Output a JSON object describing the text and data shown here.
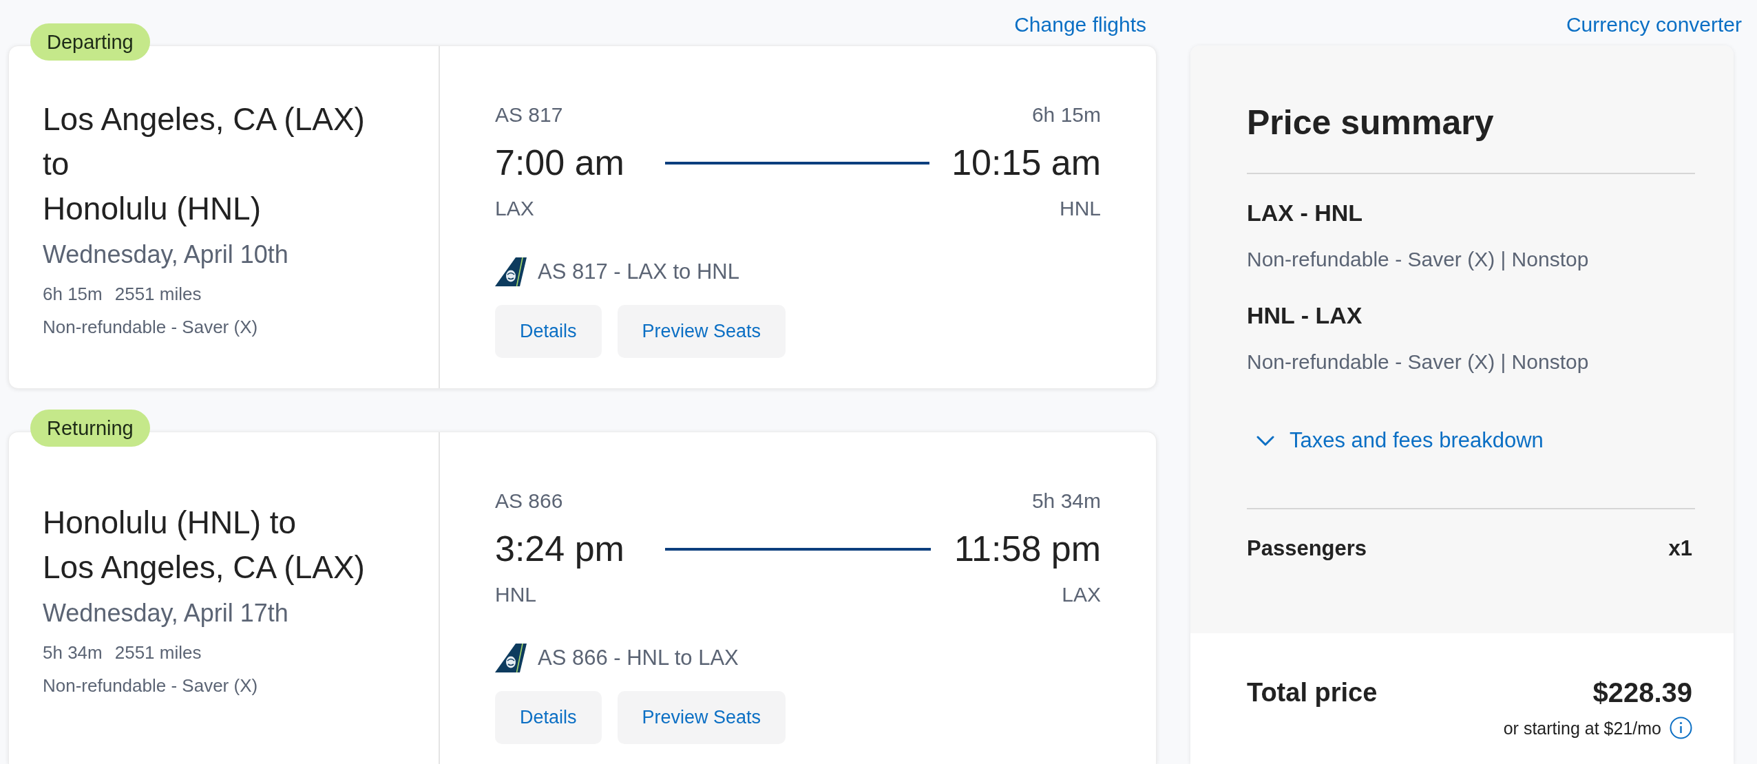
{
  "itinerary": {
    "link": "Change flights",
    "flights": [
      {
        "badge": "Departing",
        "route_lines": [
          "Los Angeles, CA (LAX)",
          "to",
          "Honolulu (HNL)"
        ],
        "date": "Wednesday, April 10th",
        "duration": "6h 15m",
        "distance": "2551 miles",
        "fare": "Non-refundable - Saver (X)",
        "flight_number": "AS 817",
        "total_time": "6h 15m",
        "depart_time": "7:00 am",
        "arrive_time": "10:15 am",
        "origin": "LAX",
        "destination": "HNL",
        "segment": "AS 817 - LAX to HNL",
        "buttons": [
          "Details",
          "Preview Seats"
        ]
      },
      {
        "badge": "Returning",
        "route_lines": [
          "Honolulu (HNL) to",
          "Los Angeles, CA (LAX)"
        ],
        "date": "Wednesday, April 17th",
        "duration": "5h 34m",
        "distance": "2551 miles",
        "fare": "Non-refundable - Saver (X)",
        "flight_number": "AS 866",
        "total_time": "5h 34m",
        "depart_time": "3:24 pm",
        "arrive_time": "11:58 pm",
        "origin": "HNL",
        "destination": "LAX",
        "segment": "AS 866 - HNL to LAX",
        "buttons": [
          "Details",
          "Preview Seats"
        ]
      }
    ]
  },
  "price_summary": {
    "link": "Currency converter",
    "title": "Price summary",
    "legs": [
      {
        "route": "LAX - HNL",
        "details": "Non-refundable - Saver (X) | Nonstop"
      },
      {
        "route": "HNL - LAX",
        "details": "Non-refundable - Saver (X) | Nonstop"
      }
    ],
    "breakdown": {
      "label": "Taxes and fees breakdown",
      "expanded": false
    },
    "passengers": {
      "label": "Passengers",
      "count": "x1"
    },
    "total": {
      "label": "Total price",
      "amount": "$228.39",
      "financing": "or starting at $21/mo"
    }
  }
}
